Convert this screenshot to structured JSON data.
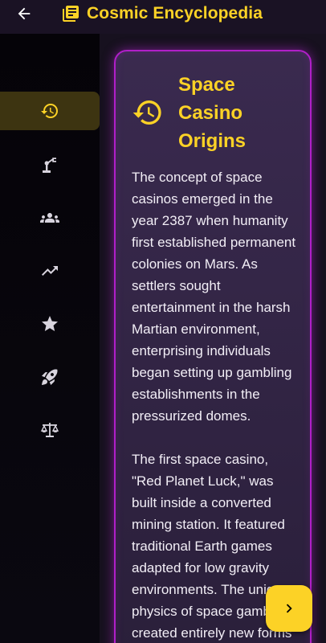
{
  "header": {
    "title": "Cosmic Encyclopedia",
    "back_icon": "arrow-back-icon",
    "title_icon": "book-icon"
  },
  "sidebar": {
    "items": [
      {
        "icon": "history-icon",
        "active": true
      },
      {
        "icon": "robot-arm-icon",
        "active": false
      },
      {
        "icon": "group-icon",
        "active": false
      },
      {
        "icon": "trending-up-icon",
        "active": false
      },
      {
        "icon": "star-icon",
        "active": false
      },
      {
        "icon": "rocket-icon",
        "active": false
      },
      {
        "icon": "balance-scale-icon",
        "active": false
      }
    ]
  },
  "card": {
    "icon": "history-icon",
    "title": "Space Casino Origins",
    "paragraphs": [
      "The concept of space casinos emerged in the year 2387 when humanity first established permanent colonies on Mars. As settlers sought entertainment in the harsh Martian environment, enterprising individuals began setting up gambling establishments in the pressurized domes.",
      "The first space casino, \"Red Planet Luck,\" was built inside a converted mining station. It featured traditional Earth games adapted for low gravity environments. The unique physics of space gambling created entirely new forms"
    ]
  },
  "fab": {
    "icon": "chevron-right-icon"
  },
  "colors": {
    "accent": "#fcd226",
    "card_border": "#b01fc8",
    "background": "#0d0914",
    "active_item": "#3d3411"
  }
}
